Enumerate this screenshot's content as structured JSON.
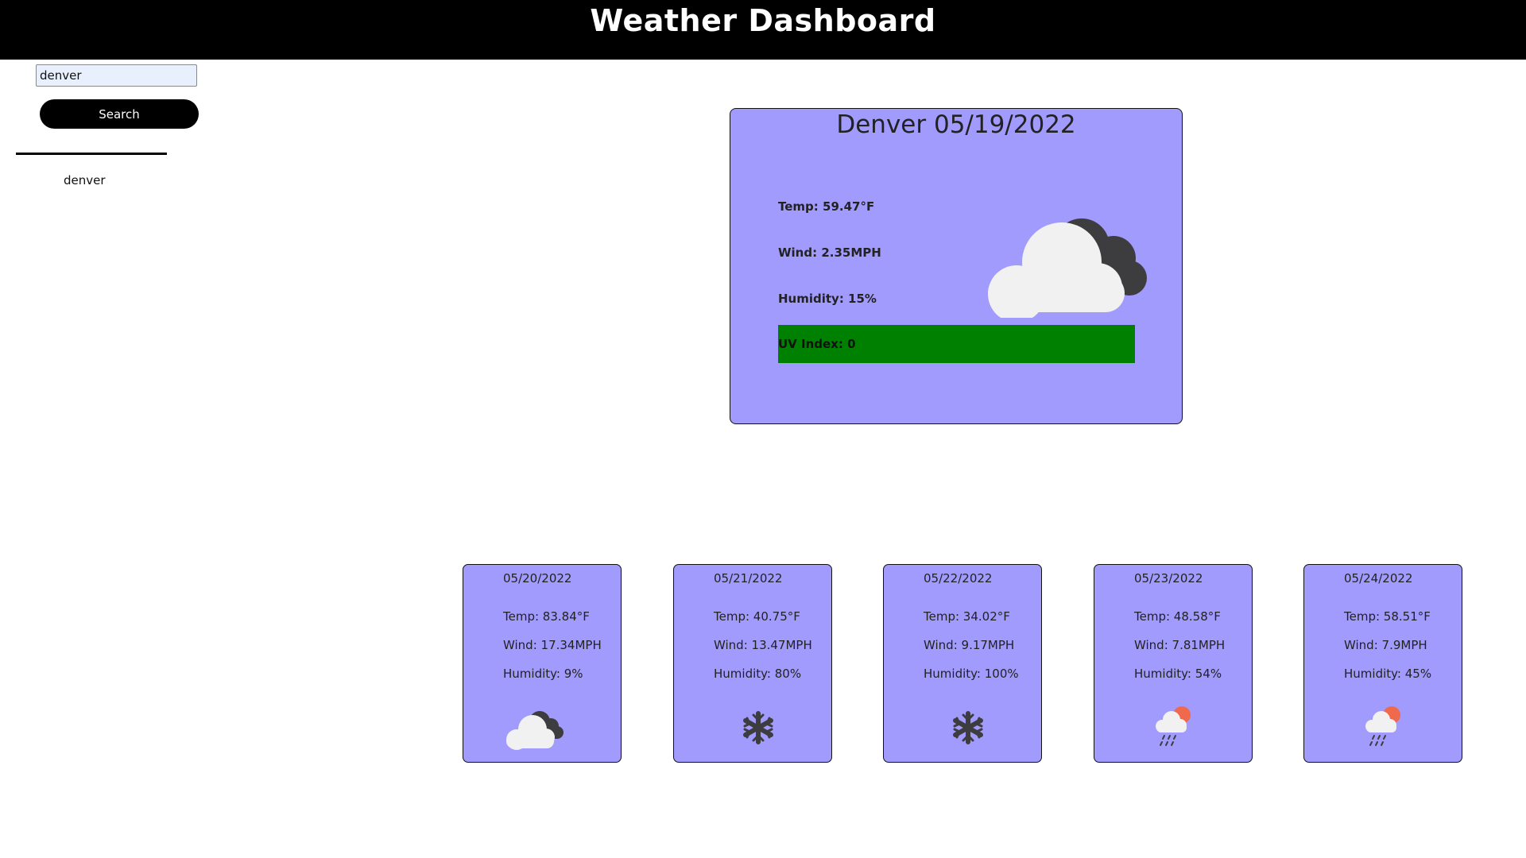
{
  "header": {
    "title": "Weather Dashboard"
  },
  "search": {
    "value": "denver",
    "button_label": "Search"
  },
  "history": [
    "denver"
  ],
  "current": {
    "title": "Denver 05/19/2022",
    "temp": "Temp: 59.47°F",
    "wind": "Wind: 2.35MPH",
    "humidity": "Humidity: 15%",
    "uv": "UV Index: 0",
    "uv_color": "#008000",
    "icon": "partly-cloudy-icon"
  },
  "forecast": [
    {
      "date": "05/20/2022",
      "temp": "Temp: 83.84°F",
      "wind": "Wind: 17.34MPH",
      "humidity": "Humidity: 9%",
      "icon": "cloudy-icon"
    },
    {
      "date": "05/21/2022",
      "temp": "Temp: 40.75°F",
      "wind": "Wind: 13.47MPH",
      "humidity": "Humidity: 80%",
      "icon": "snow-icon"
    },
    {
      "date": "05/22/2022",
      "temp": "Temp: 34.02°F",
      "wind": "Wind: 9.17MPH",
      "humidity": "Humidity: 100%",
      "icon": "snow-icon"
    },
    {
      "date": "05/23/2022",
      "temp": "Temp: 48.58°F",
      "wind": "Wind: 7.81MPH",
      "humidity": "Humidity: 54%",
      "icon": "rain-sun-icon"
    },
    {
      "date": "05/24/2022",
      "temp": "Temp: 58.51°F",
      "wind": "Wind: 7.9MPH",
      "humidity": "Humidity: 45%",
      "icon": "rain-sun-icon"
    }
  ],
  "colors": {
    "card": "#a29bfe",
    "header": "#000000",
    "uv_low": "#008000"
  }
}
